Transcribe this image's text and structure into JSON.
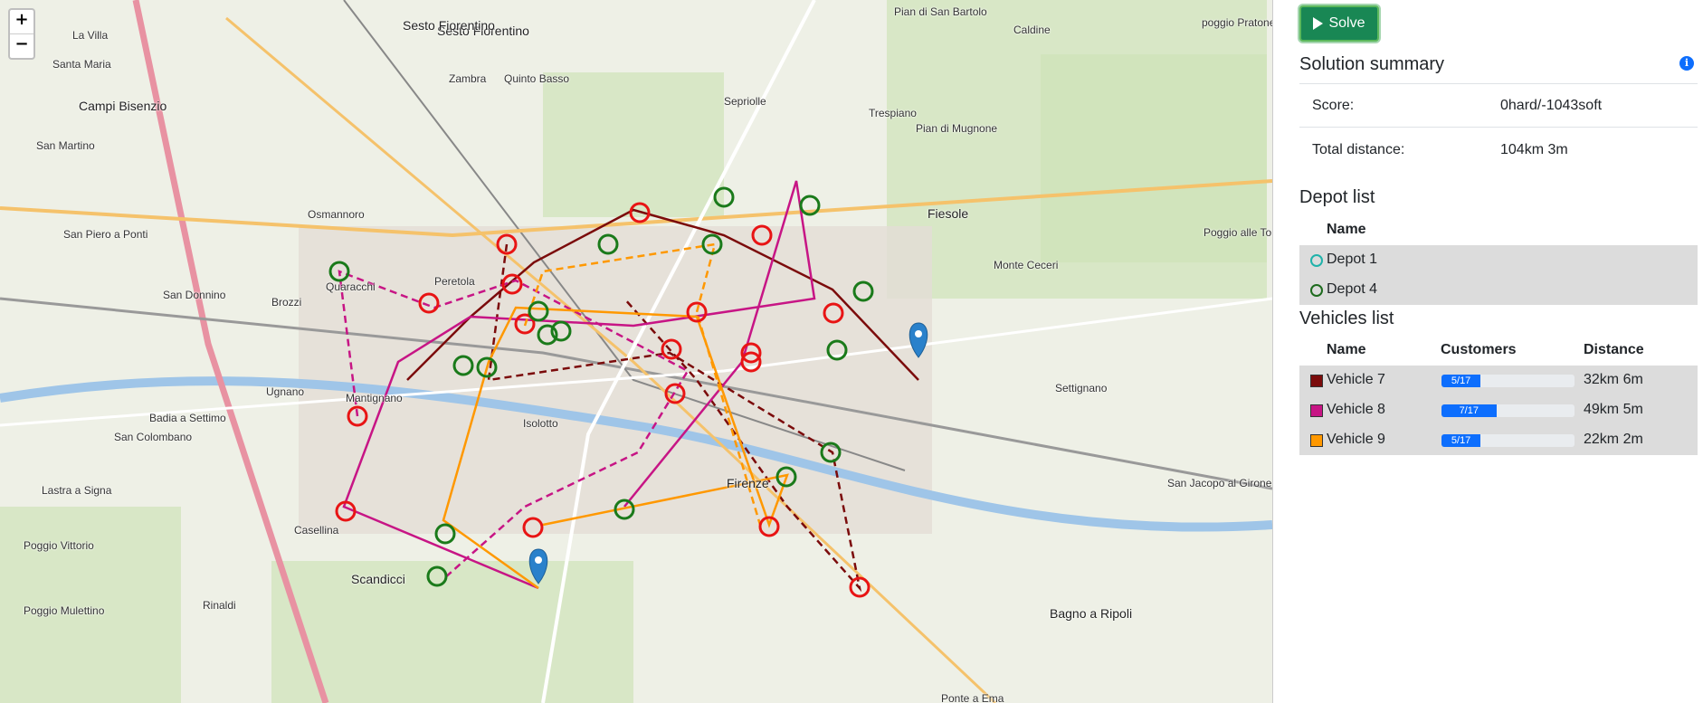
{
  "map": {
    "zoom_in": "+",
    "zoom_out": "−",
    "labels": [
      "Sesto Fiorentino",
      "La Villa",
      "Santa Maria",
      "Campi Bisenzio",
      "San Martino",
      "Osmannoro",
      "Zambra",
      "Quinto Basso",
      "Sesto Fiorentino",
      "Peretola",
      "Quaracchi",
      "Brozzi",
      "San Donnino",
      "San Piero a Ponti",
      "Ugnano",
      "Mantignano",
      "Badia a Settimo",
      "San Colombano",
      "Casellina",
      "Scandicci",
      "Rinaldi",
      "Isolotto",
      "Firenze",
      "Fiesole",
      "Sepriolle",
      "Trespiano",
      "Pian di Mugnone",
      "Pian di San Bartolo",
      "Caldine",
      "Settignano",
      "San Jacopo al Girone",
      "Bagno a Ripoli",
      "Ponte a Ema",
      "Poggio Vittorio",
      "Poggio Mulettino",
      "poggio Pratone",
      "Poggio alle Tortore",
      "Monte Ceceri",
      "Lastra a Signa"
    ]
  },
  "toolbar": {
    "solve_label": "Solve"
  },
  "summary": {
    "title": "Solution summary",
    "score_label": "Score:",
    "score_value": "0hard/-1043soft",
    "distance_label": "Total distance:",
    "distance_value": "104km 3m"
  },
  "depots": {
    "title": "Depot list",
    "header_name": "Name",
    "items": [
      {
        "name": "Depot 1",
        "color": "#20b2aa"
      },
      {
        "name": "Depot 4",
        "color": "#1e6b1e"
      }
    ]
  },
  "vehicles": {
    "title": "Vehicles list",
    "header_name": "Name",
    "header_customers": "Customers",
    "header_distance": "Distance",
    "items": [
      {
        "name": "Vehicle 7",
        "color": "#7b0b0b",
        "customers": "5/17",
        "fill": 0.294,
        "distance": "32km 6m"
      },
      {
        "name": "Vehicle 8",
        "color": "#c71585",
        "customers": "7/17",
        "fill": 0.412,
        "distance": "49km 5m"
      },
      {
        "name": "Vehicle 9",
        "color": "#ff9800",
        "customers": "5/17",
        "fill": 0.294,
        "distance": "22km 2m"
      }
    ]
  }
}
